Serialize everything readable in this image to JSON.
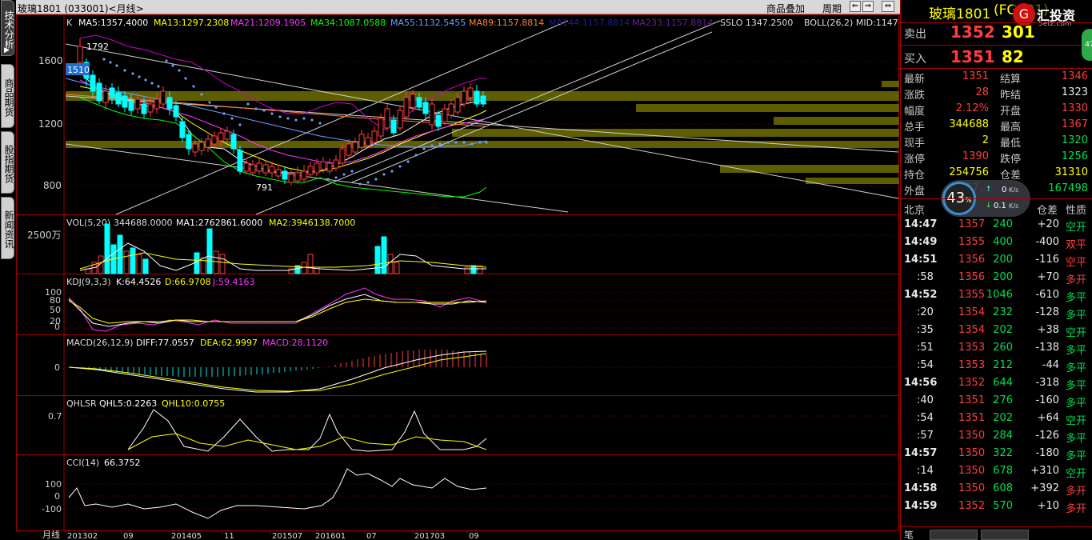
{
  "titlebar": {
    "symbol": "玻璃1801 (033001)<月线>",
    "menu_goods": "商品叠加",
    "menu_period": "周期"
  },
  "sidetabs": [
    "技术分析",
    "商品期货",
    "股指期货",
    "新闻资讯"
  ],
  "legend": {
    "k": "K",
    "ma5": "MA5:1357.4000",
    "ma13": "MA13:1297.2308",
    "ma21": "MA21:1209.1905",
    "ma34": "MA34:1087.0588",
    "ma55": "MA55:1132.5455",
    "ma89": "MA89:1157.8814",
    "ma144": "MA144:1157.8814",
    "ma233": "MA233:1157.8814",
    "sslo": "SSLO  1347.2500",
    "boll": "BOLL(26,2)  MID:1147"
  },
  "price_ticks": [
    "1600",
    "1200",
    "800"
  ],
  "price_marks": {
    "high": "1792",
    "box": "1510",
    "low": "791"
  },
  "vol": {
    "title": "VOL(5,20)",
    "v": "344688.0000",
    "ma1": "MA1:2762861.6000",
    "ma2": "MA2:3946138.7000",
    "tick": "2500万"
  },
  "kdj": {
    "title": "KDJ(9,3,3)",
    "k": "K:64.4526",
    "d": "D:66.9708",
    "j": "J:59.4163",
    "ticks": [
      "100",
      "80",
      "50",
      "20",
      "0"
    ]
  },
  "macd": {
    "title": "MACD(26,12,9)",
    "diff": "DIFF:77.0557",
    "dea": "DEA:62.9997",
    "macd": "MACD:28.1120",
    "tick": "0"
  },
  "qhlsr": {
    "title": "QHLSR",
    "q5": "QHL5:0.2263",
    "q10": "QHL10:0.0755",
    "tick": "0.7"
  },
  "cci": {
    "title": "CCI(14)",
    "v": "66.3752",
    "ticks": [
      "100",
      "0",
      "-100"
    ]
  },
  "xaxis": {
    "label": "月线",
    "dates": [
      "201302",
      "09",
      "201405",
      "11",
      "201507",
      "201601",
      "07",
      "201703",
      "09"
    ]
  },
  "panel": {
    "name": "玻璃1801",
    "code": "(FG801)",
    "logo": "Ⓖ汇投资",
    "logo_url": "5etz.com",
    "sell_label": "卖出",
    "sell_price": "1352",
    "sell_vol": "301",
    "buy_label": "买入",
    "buy_price": "1351",
    "buy_vol": "82",
    "badge": "47",
    "rows": [
      {
        "l": "最新",
        "v": "1351",
        "c": "red",
        "l2": "结算",
        "v2": "1346",
        "c2": "red"
      },
      {
        "l": "涨跌",
        "v": "28",
        "c": "red",
        "l2": "昨结",
        "v2": "1323",
        "c2": "wht"
      },
      {
        "l": "幅度",
        "v": "2.12%",
        "c": "red",
        "l2": "开盘",
        "v2": "1330",
        "c2": "red"
      },
      {
        "l": "总手",
        "v": "344688",
        "c": "yel",
        "l2": "最高",
        "v2": "1367",
        "c2": "red"
      },
      {
        "l": "现手",
        "v": "2",
        "c": "yel",
        "l2": "最低",
        "v2": "1320",
        "c2": "grn"
      },
      {
        "l": "涨停",
        "v": "1390",
        "c": "red",
        "l2": "跌停",
        "v2": "1256",
        "c2": "grn"
      },
      {
        "l": "持仓",
        "v": "254756",
        "c": "yel",
        "l2": "仓差",
        "v2": "31310",
        "c2": "yel"
      },
      {
        "l": "外盘",
        "v": "17...",
        "c": "red",
        "l2": "",
        "v2": "167498",
        "c2": "grn"
      }
    ],
    "meter": {
      "pct": "43",
      "unit": "%",
      "up": "0",
      "down": "0.1",
      "rate_unit": "K/s"
    },
    "tick_header": {
      "loc": "北京",
      "oi": "仓差",
      "nature": "性质"
    },
    "ticks": [
      {
        "t": "14:47",
        "p": "1357",
        "v": "240",
        "oi": "+20",
        "n": "空开",
        "nc": "grn"
      },
      {
        "t": "14:49",
        "p": "1355",
        "v": "400",
        "oi": "-400",
        "n": "双平",
        "nc": "red"
      },
      {
        "t": "14:51",
        "p": "1356",
        "v": "200",
        "oi": "-116",
        "n": "空平",
        "nc": "red"
      },
      {
        "t": ":58",
        "p": "1356",
        "v": "200",
        "oi": "+70",
        "n": "多开",
        "nc": "red"
      },
      {
        "t": "14:52",
        "p": "1355",
        "v": "1046",
        "oi": "-610",
        "n": "多平",
        "nc": "grn"
      },
      {
        "t": ":20",
        "p": "1354",
        "v": "232",
        "oi": "-128",
        "n": "多平",
        "nc": "grn"
      },
      {
        "t": ":35",
        "p": "1354",
        "v": "202",
        "oi": "+38",
        "n": "空开",
        "nc": "grn"
      },
      {
        "t": ":51",
        "p": "1353",
        "v": "260",
        "oi": "-138",
        "n": "多平",
        "nc": "grn"
      },
      {
        "t": ":54",
        "p": "1353",
        "v": "212",
        "oi": "-44",
        "n": "多平",
        "nc": "grn"
      },
      {
        "t": "14:56",
        "p": "1352",
        "v": "644",
        "oi": "-318",
        "n": "多平",
        "nc": "grn"
      },
      {
        "t": ":40",
        "p": "1351",
        "v": "276",
        "oi": "-160",
        "n": "多平",
        "nc": "grn"
      },
      {
        "t": ":54",
        "p": "1351",
        "v": "202",
        "oi": "+64",
        "n": "空开",
        "nc": "grn"
      },
      {
        "t": ":57",
        "p": "1350",
        "v": "284",
        "oi": "-126",
        "n": "多平",
        "nc": "grn"
      },
      {
        "t": "14:57",
        "p": "1350",
        "v": "322",
        "oi": "-180",
        "n": "多平",
        "nc": "grn"
      },
      {
        "t": ":14",
        "p": "1350",
        "v": "678",
        "oi": "+310",
        "n": "空开",
        "nc": "grn"
      },
      {
        "t": "14:58",
        "p": "1350",
        "v": "608",
        "oi": "+392",
        "n": "多开",
        "nc": "red"
      },
      {
        "t": "14:59",
        "p": "1352",
        "v": "570",
        "oi": "+10",
        "n": "多开",
        "nc": "red"
      }
    ],
    "bottom": "笔"
  },
  "colors": {
    "up": "#ff3c3c",
    "down": "#00ffff",
    "grid": "#8b0000",
    "ma5": "#ffffff",
    "ma13": "#ffff00",
    "ma21": "#ff00ff",
    "ma34": "#00ff00",
    "ma55": "#6aa0ff",
    "ma89": "#ff8030",
    "band": "#6b6b00"
  }
}
